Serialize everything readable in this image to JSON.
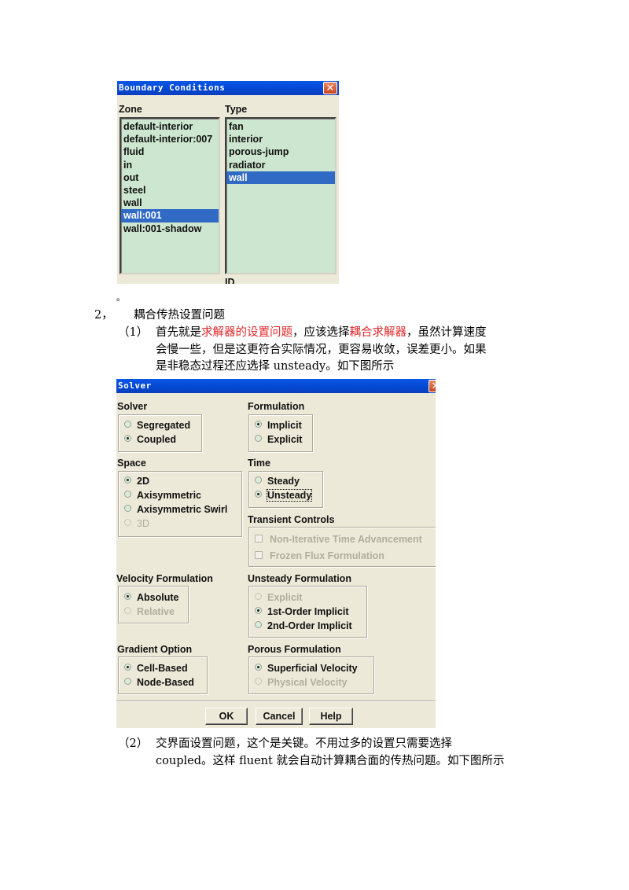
{
  "boundary_dialog": {
    "title": "Boundary Conditions",
    "close_glyph": "✕",
    "zone_label": "Zone",
    "type_label": "Type",
    "zones": [
      "default-interior",
      "default-interior:007",
      "fluid",
      "in",
      "out",
      "steel",
      "wall",
      "wall:001",
      "wall:001-shadow"
    ],
    "selected_zone": "wall:001",
    "types": [
      "fan",
      "interior",
      "porous-jump",
      "radiator",
      "wall"
    ],
    "selected_type": "wall",
    "id_label": "ID"
  },
  "doc": {
    "stray_mark": "。",
    "section_number": "2，",
    "section_title": "耦合传热设置问题",
    "item1_number": "（1）",
    "item1_line1_a": "首先就是",
    "item1_line1_red1": "求解器的设置问题",
    "item1_line1_b": "，应该选择",
    "item1_line1_red2": "耦合求解器",
    "item1_line1_c": "，虽然计算速度",
    "item1_line2": "会慢一些，但是这更符合实际情况，更容易收敛，误差更小。如果",
    "item1_line3": "是非稳态过程还应选择 unsteady。如下图所示",
    "item2_number": "（2）",
    "item2_line1": "交界面设置问题，这个是关键。不用过多的设置只需要选择",
    "item2_line2": "coupled。这样 fluent 就会自动计算耦合面的传热问题。如下图所示"
  },
  "solver_dialog": {
    "title": "Solver",
    "close_glyph": "✕",
    "solver": {
      "label": "Solver",
      "options": [
        "Segregated",
        "Coupled"
      ],
      "selected": "Coupled"
    },
    "formulation": {
      "label": "Formulation",
      "options": [
        "Implicit",
        "Explicit"
      ],
      "selected": "Implicit"
    },
    "space": {
      "label": "Space",
      "options": [
        "2D",
        "Axisymmetric",
        "Axisymmetric Swirl",
        "3D"
      ],
      "selected": "2D",
      "disabled": [
        "3D"
      ]
    },
    "time": {
      "label": "Time",
      "options": [
        "Steady",
        "Unsteady"
      ],
      "selected": "Unsteady"
    },
    "transient_controls": {
      "label": "Transient Controls",
      "options": [
        "Non-Iterative Time Advancement",
        "Frozen Flux Formulation"
      ],
      "checked": [],
      "disabled": true
    },
    "velocity_formulation": {
      "label": "Velocity Formulation",
      "options": [
        "Absolute",
        "Relative"
      ],
      "selected": "Absolute",
      "disabled": [
        "Relative"
      ]
    },
    "unsteady_formulation": {
      "label": "Unsteady Formulation",
      "options": [
        "Explicit",
        "1st-Order Implicit",
        "2nd-Order Implicit"
      ],
      "selected": "1st-Order Implicit",
      "disabled": [
        "Explicit"
      ]
    },
    "gradient_option": {
      "label": "Gradient Option",
      "options": [
        "Cell-Based",
        "Node-Based"
      ],
      "selected": "Cell-Based"
    },
    "porous_formulation": {
      "label": "Porous Formulation",
      "options": [
        "Superficial Velocity",
        "Physical Velocity"
      ],
      "selected": "Superficial Velocity",
      "disabled": [
        "Physical Velocity"
      ]
    },
    "buttons": {
      "ok": "OK",
      "cancel": "Cancel",
      "help": "Help"
    }
  }
}
